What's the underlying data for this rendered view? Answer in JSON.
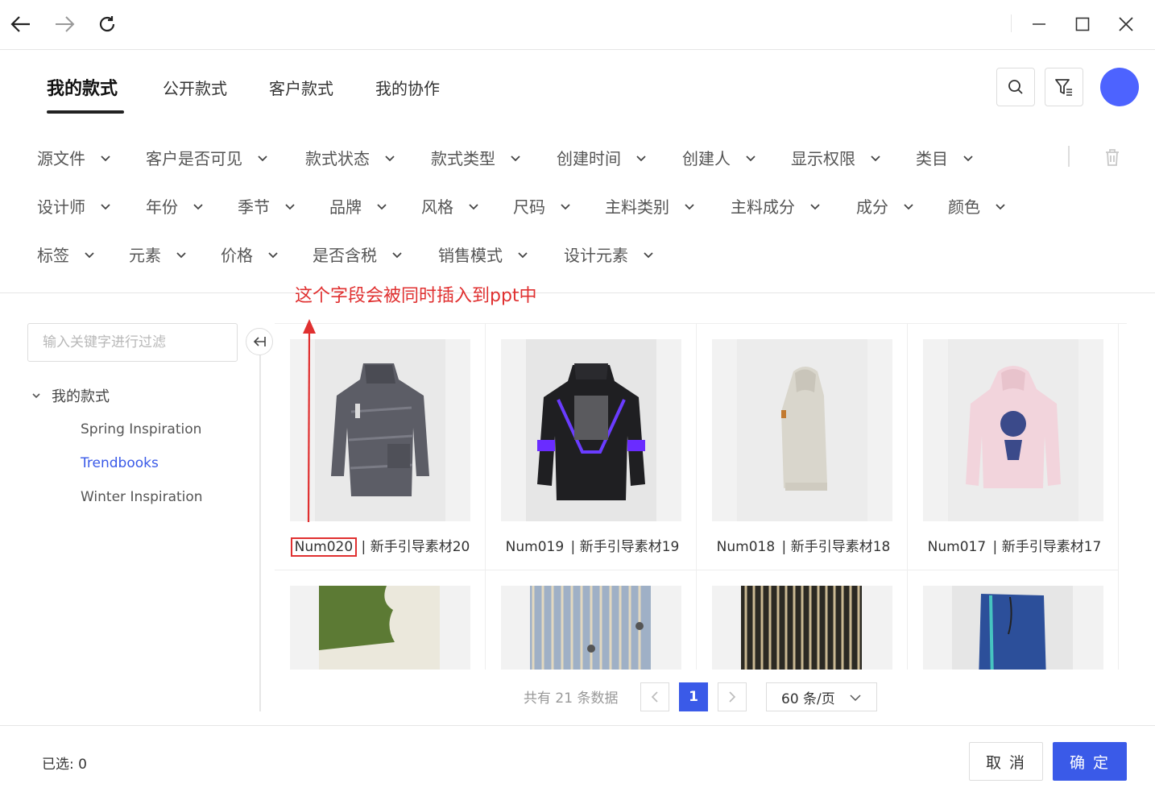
{
  "nav": {
    "back_icon": "arrow-left-icon",
    "forward_icon": "arrow-right-icon",
    "refresh_icon": "refresh-icon"
  },
  "window": {
    "minimize_icon": "minimize-icon",
    "maximize_icon": "maximize-icon",
    "close_icon": "close-icon"
  },
  "tabs": [
    {
      "label": "我的款式",
      "active": true
    },
    {
      "label": "公开款式",
      "active": false
    },
    {
      "label": "客户款式",
      "active": false
    },
    {
      "label": "我的协作",
      "active": false
    }
  ],
  "toolbar": {
    "search_icon": "search-icon",
    "filter_icon": "filter-icon",
    "avatar_color": "#4d63ff"
  },
  "filters": {
    "row1": [
      "源文件",
      "客户是否可见",
      "款式状态",
      "款式类型",
      "创建时间",
      "创建人",
      "显示权限",
      "类目"
    ],
    "row2": [
      "设计师",
      "年份",
      "季节",
      "品牌",
      "风格",
      "尺码",
      "主料类别",
      "主料成分",
      "成分",
      "颜色"
    ],
    "row3": [
      "标签",
      "元素",
      "价格",
      "是否含税",
      "销售模式",
      "设计元素"
    ]
  },
  "annotation": {
    "text": "这个字段会被同时插入到ppt中",
    "color": "#e03030"
  },
  "sidebar": {
    "search_placeholder": "输入关键字进行过滤",
    "root_label": "我的款式",
    "items": [
      {
        "label": "Spring Inspiration",
        "active": false
      },
      {
        "label": "Trendbooks",
        "active": true
      },
      {
        "label": "Winter Inspiration",
        "active": false
      }
    ]
  },
  "cards": [
    {
      "code": "Num020",
      "sep": " | ",
      "name": "新手引导素材20",
      "img": "puffer-jacket"
    },
    {
      "code": "Num019",
      "sep": " | ",
      "name": "新手引导素材19",
      "img": "colorblock-jacket"
    },
    {
      "code": "Num018",
      "sep": " | ",
      "name": "新手引导素材18",
      "img": "beige-hoodie"
    },
    {
      "code": "Num017",
      "sep": " | ",
      "name": "新手引导素材17",
      "img": "pink-hoodie"
    },
    {
      "code": "",
      "sep": "",
      "name": "",
      "img": "green-fabric"
    },
    {
      "code": "",
      "sep": "",
      "name": "",
      "img": "striped-shirt"
    },
    {
      "code": "",
      "sep": "",
      "name": "",
      "img": "striped-fabric"
    },
    {
      "code": "",
      "sep": "",
      "name": "",
      "img": "blue-pants"
    }
  ],
  "pagination": {
    "total_text": "共有 21 条数据",
    "current_page": "1",
    "page_size": "60 条/页"
  },
  "footer": {
    "selected_text": "已选: 0",
    "cancel_label": "取 消",
    "ok_label": "确 定"
  },
  "colors": {
    "primary": "#3a5ae8",
    "annotation": "#e03030"
  }
}
